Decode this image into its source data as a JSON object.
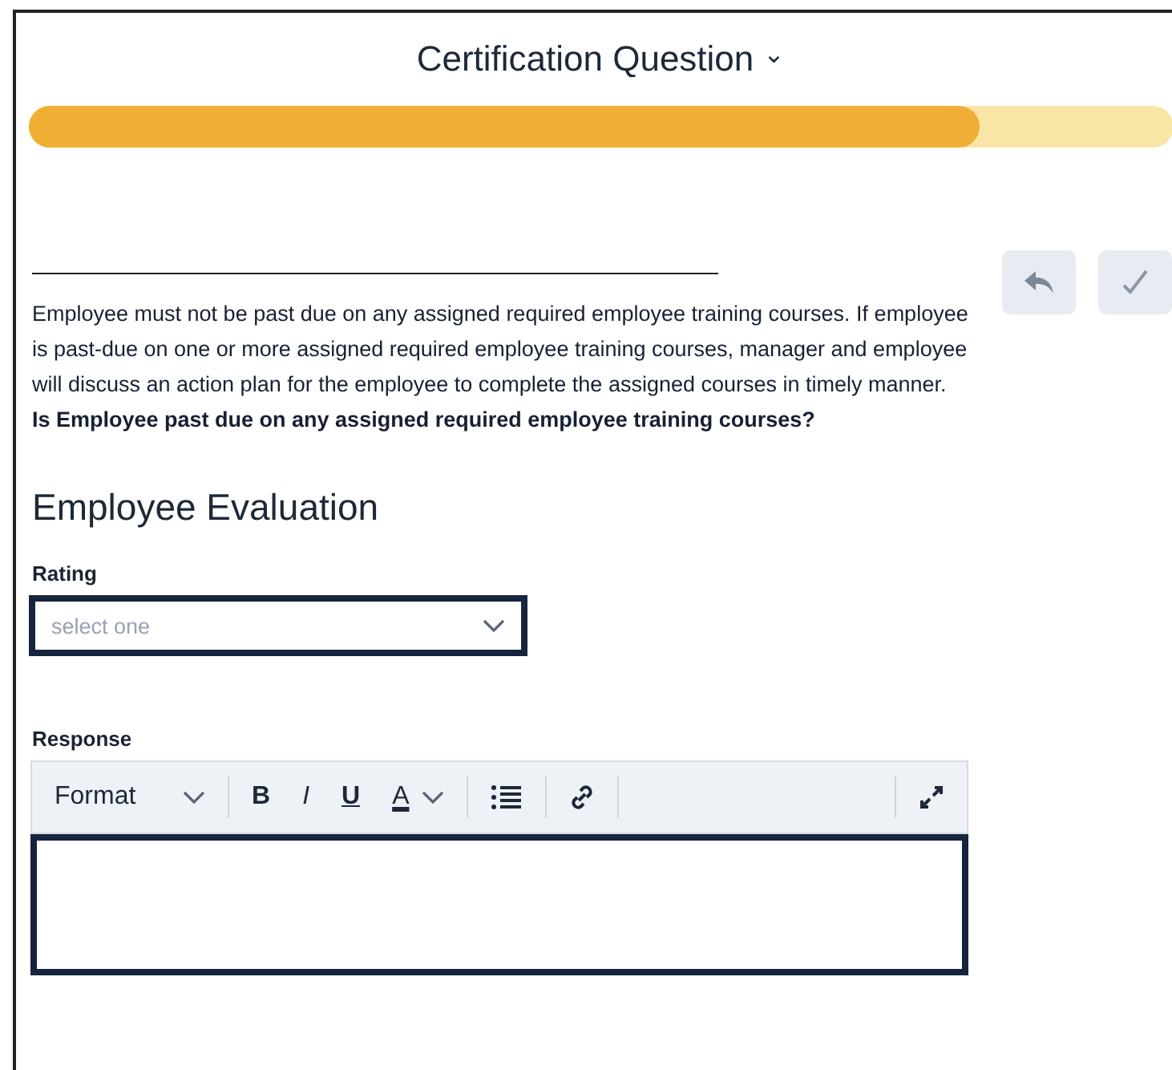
{
  "header": {
    "title": "Certification Question",
    "caret": "⌄"
  },
  "progress": {
    "level": 0.83
  },
  "actions": [
    {
      "kind": "back"
    },
    {
      "kind": "check"
    }
  ],
  "description": "Employee must not be past due on any assigned required employee training courses. If employee is past-due on one or more assigned required employee training courses, manager and employee will discuss an action plan for the employee to complete the assigned courses in timely manner.",
  "question": "Is Employee past due on any assigned required employee training courses?",
  "section_title": "Employee Evaluation",
  "rating": {
    "label": "Rating",
    "placeholder": "select one"
  },
  "response": {
    "label": "Response",
    "toolbar": [
      {
        "kind": "format",
        "label": "Format"
      },
      {
        "kind": "bold",
        "label": "B"
      },
      {
        "kind": "italic",
        "label": "I"
      },
      {
        "kind": "underline",
        "label": "U"
      },
      {
        "kind": "color",
        "label": "A"
      },
      {
        "kind": "list"
      },
      {
        "kind": "link"
      },
      {
        "kind": "expand"
      }
    ]
  }
}
